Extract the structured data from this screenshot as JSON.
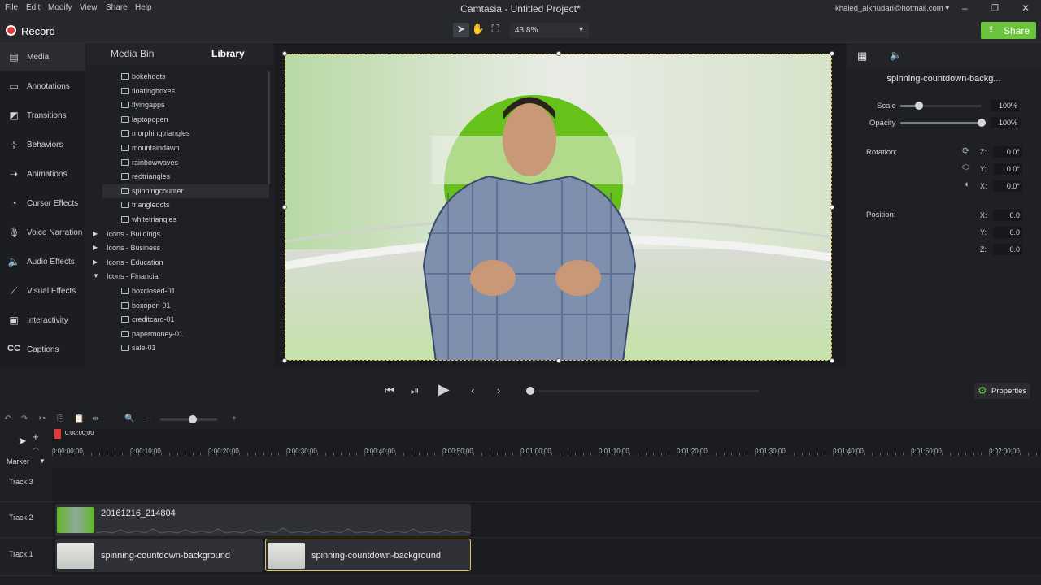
{
  "menubar": {
    "items": [
      "File",
      "Edit",
      "Modify",
      "View",
      "Share",
      "Help"
    ],
    "title": "Camtasia - Untitled Project*",
    "account": "khaled_alkhudari@hotmail.com"
  },
  "toolbar": {
    "record_label": "Record",
    "zoom_value": "43.8%",
    "share_label": "Share"
  },
  "sidebar": {
    "items": [
      {
        "label": "Media",
        "icon": "media-icon"
      },
      {
        "label": "Annotations",
        "icon": "annotations-icon"
      },
      {
        "label": "Transitions",
        "icon": "transitions-icon"
      },
      {
        "label": "Behaviors",
        "icon": "behaviors-icon"
      },
      {
        "label": "Animations",
        "icon": "animations-icon"
      },
      {
        "label": "Cursor Effects",
        "icon": "cursor-icon"
      },
      {
        "label": "Voice Narration",
        "icon": "microphone-icon"
      },
      {
        "label": "Audio Effects",
        "icon": "speaker-icon"
      },
      {
        "label": "Visual Effects",
        "icon": "wand-icon"
      },
      {
        "label": "Interactivity",
        "icon": "interactivity-icon"
      },
      {
        "label": "Captions",
        "icon": "captions-icon"
      }
    ]
  },
  "library": {
    "tabs": [
      "Media Bin",
      "Library"
    ],
    "items": [
      {
        "label": "bokehdots",
        "type": "file"
      },
      {
        "label": "floatingboxes",
        "type": "file"
      },
      {
        "label": "flyingapps",
        "type": "file"
      },
      {
        "label": "laptopopen",
        "type": "file"
      },
      {
        "label": "morphingtriangles",
        "type": "file"
      },
      {
        "label": "mountaindawn",
        "type": "file"
      },
      {
        "label": "rainbowwaves",
        "type": "file"
      },
      {
        "label": "redtriangles",
        "type": "file"
      },
      {
        "label": "spinningcounter",
        "type": "file"
      },
      {
        "label": "triangledots",
        "type": "file"
      },
      {
        "label": "whitetriangles",
        "type": "file"
      },
      {
        "label": "Icons - Buildings",
        "type": "folder"
      },
      {
        "label": "Icons - Business",
        "type": "folder"
      },
      {
        "label": "Icons - Education",
        "type": "folder"
      },
      {
        "label": "Icons - Financial",
        "type": "folder-open"
      },
      {
        "label": "boxclosed-01",
        "type": "image"
      },
      {
        "label": "boxopen-01",
        "type": "image"
      },
      {
        "label": "creditcard-01",
        "type": "image"
      },
      {
        "label": "papermoney-01",
        "type": "image"
      },
      {
        "label": "sale-01",
        "type": "image"
      }
    ]
  },
  "properties": {
    "title": "spinning-countdown-backg...",
    "scale_label": "Scale",
    "scale_value": "100%",
    "opacity_label": "Opacity",
    "opacity_value": "100%",
    "rotation_label": "Rotation:",
    "rotation": [
      {
        "axis": "Z:",
        "value": "0.0°"
      },
      {
        "axis": "Y:",
        "value": "0.0°"
      },
      {
        "axis": "X:",
        "value": "0.0°"
      }
    ],
    "position_label": "Position:",
    "position": [
      {
        "axis": "X:",
        "value": "0.0"
      },
      {
        "axis": "Y:",
        "value": "0.0"
      },
      {
        "axis": "Z:",
        "value": "0.0"
      }
    ],
    "properties_button": "Properties"
  },
  "timeline": {
    "playhead_time": "0:00:00;00",
    "ruler": [
      "0:00:00;00",
      "0:00:10;00",
      "0:00:20;00",
      "0:00:30;00",
      "0:00:40;00",
      "0:00:50;00",
      "0:01:00;00",
      "0:01:10;00",
      "0:01:20;00",
      "0:01:30;00",
      "0:01:40;00",
      "0:01:50;00",
      "0:02:00;00"
    ],
    "marker_label": "Marker",
    "tracks": [
      {
        "label": "Track 3",
        "clips": []
      },
      {
        "label": "Track 2",
        "clips": [
          {
            "label": "20161216_214804"
          }
        ]
      },
      {
        "label": "Track 1",
        "clips": [
          {
            "label": "spinning-countdown-background"
          },
          {
            "label": "spinning-countdown-background"
          }
        ]
      }
    ]
  },
  "colors": {
    "accent_green": "#6ac43d",
    "record_red": "#e53935",
    "selection_gold": "#e3c15a"
  }
}
